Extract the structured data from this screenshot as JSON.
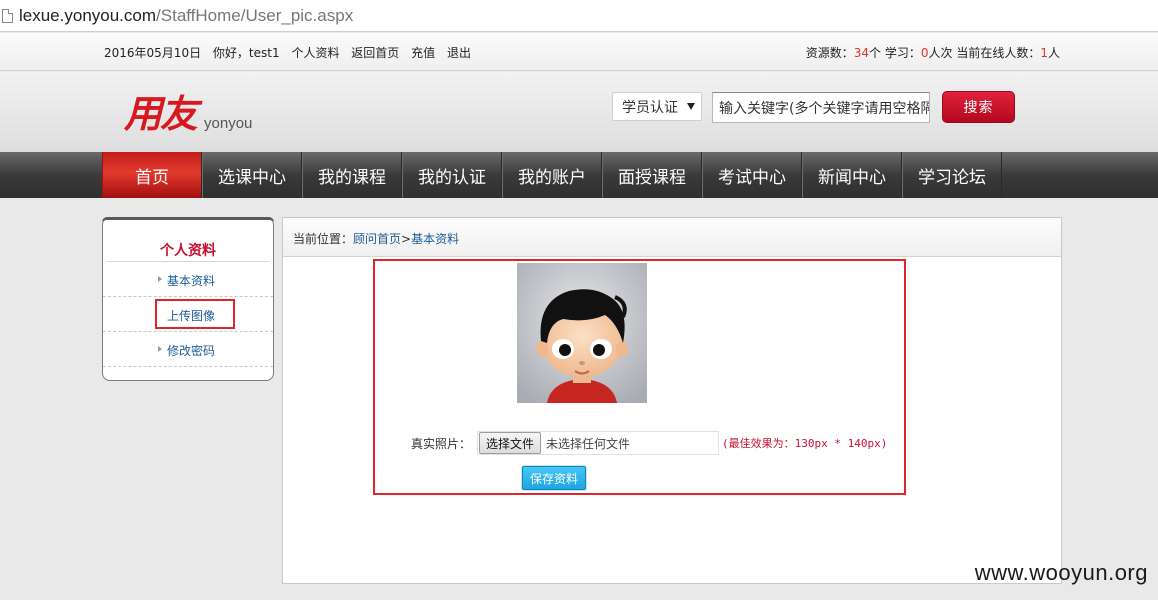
{
  "browser": {
    "url_host": "lexue.yonyou.com",
    "url_path": "/StaffHome/User_pic.aspx"
  },
  "topbar": {
    "date": "2016年05月10日",
    "greeting": "你好，test1",
    "links": [
      "个人资料",
      "返回首页",
      "充值",
      "退出"
    ],
    "stats_resource_label": "资源数：",
    "stats_resource_value": "34",
    "stats_resource_unit": "个 学习：",
    "stats_study_value": "0",
    "stats_study_unit": "人次 当前在线人数：",
    "stats_online_value": "1",
    "stats_online_unit": "人",
    "accent_color": "#e0312f"
  },
  "header": {
    "logo_cn": "用友",
    "logo_en": "yonyou",
    "select_value": "学员认证",
    "search_placeholder": "输入关键字(多个关键字请用空格隔开)",
    "search_button": "搜索"
  },
  "nav": {
    "items": [
      {
        "label": "首页",
        "active": true
      },
      {
        "label": "选课中心",
        "active": false
      },
      {
        "label": "我的课程",
        "active": false
      },
      {
        "label": "我的认证",
        "active": false
      },
      {
        "label": "我的账户",
        "active": false
      },
      {
        "label": "面授课程",
        "active": false
      },
      {
        "label": "考试中心",
        "active": false
      },
      {
        "label": "新闻中心",
        "active": false
      },
      {
        "label": "学习论坛",
        "active": false
      }
    ]
  },
  "sidebar": {
    "title": "个人资料",
    "items": [
      {
        "label": "基本资料"
      },
      {
        "label": "上传图像"
      },
      {
        "label": "修改密码"
      }
    ]
  },
  "main": {
    "crumb_prefix": "当前位置：",
    "crumb_home": "顾问首页",
    "crumb_sep": ">",
    "crumb_current": "基本资料",
    "photo_label": "真实照片：",
    "file_button": "选择文件",
    "file_status": "未选择任何文件",
    "hint": "(最佳效果为：130px * 140px)",
    "save_button": "保存资料"
  },
  "watermark": "www.wooyun.org"
}
